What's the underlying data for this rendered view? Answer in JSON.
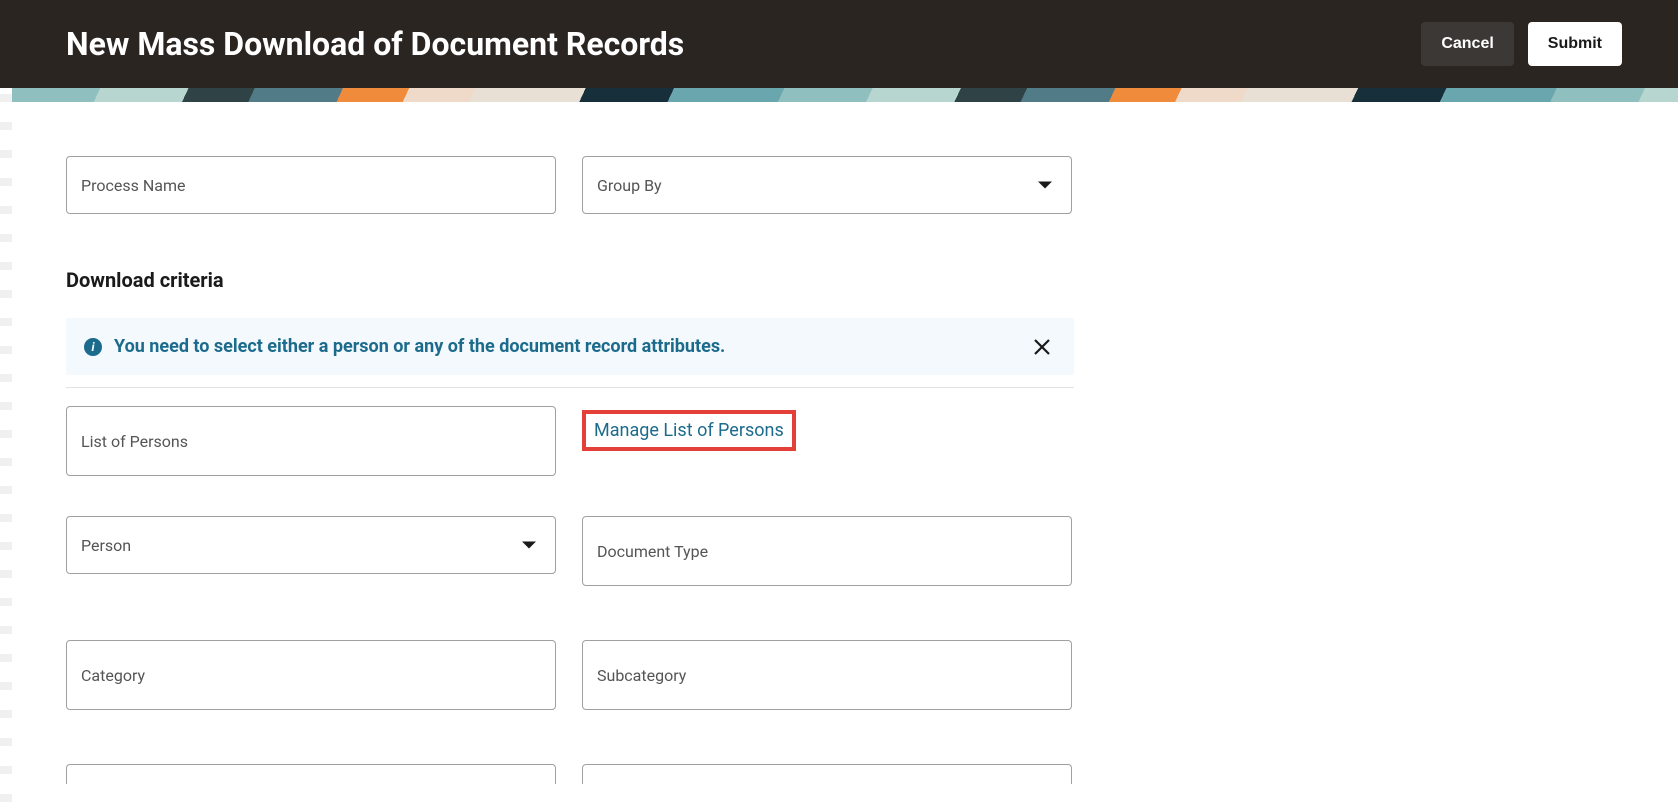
{
  "header": {
    "title": "New Mass Download of Document Records",
    "cancel_label": "Cancel",
    "submit_label": "Submit"
  },
  "fields": {
    "process_name": {
      "label": "Process Name"
    },
    "group_by": {
      "label": "Group By"
    },
    "list_of_persons": {
      "label": "List of Persons"
    },
    "person": {
      "label": "Person"
    },
    "document_type": {
      "label": "Document Type"
    },
    "category": {
      "label": "Category"
    },
    "subcategory": {
      "label": "Subcategory"
    }
  },
  "section": {
    "download_criteria_title": "Download criteria"
  },
  "info_banner": {
    "text": "You need to select either a person or any of the document record attributes."
  },
  "links": {
    "manage_persons": "Manage List of Persons"
  }
}
